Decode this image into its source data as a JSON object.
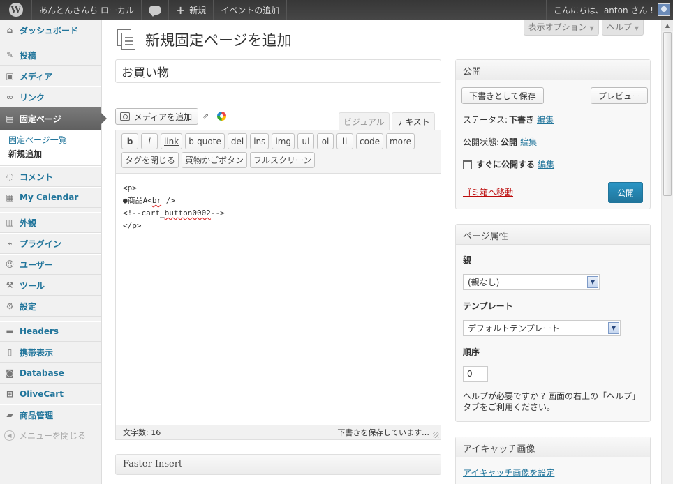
{
  "adminbar": {
    "site_name": "あんとんさんち ローカル",
    "new_label": "新規",
    "event_label": "イベントの追加",
    "greeting": "こんにちは、anton さん !"
  },
  "sidebar": {
    "items": [
      {
        "label": "ダッシュボード",
        "icon": "dashboard-icon"
      },
      {
        "label": "投稿",
        "icon": "pin-icon"
      },
      {
        "label": "メディア",
        "icon": "media-icon"
      },
      {
        "label": "リンク",
        "icon": "link-icon"
      },
      {
        "label": "固定ページ",
        "icon": "pages-icon"
      },
      {
        "label": "コメント",
        "icon": "comment-icon"
      },
      {
        "label": "My Calendar",
        "icon": "calendar-icon"
      },
      {
        "label": "外観",
        "icon": "appearance-icon"
      },
      {
        "label": "プラグイン",
        "icon": "plugin-icon"
      },
      {
        "label": "ユーザー",
        "icon": "users-icon"
      },
      {
        "label": "ツール",
        "icon": "tools-icon"
      },
      {
        "label": "設定",
        "icon": "settings-icon"
      },
      {
        "label": "Headers",
        "icon": "headers-icon"
      },
      {
        "label": "携帯表示",
        "icon": "mobile-icon"
      },
      {
        "label": "Database",
        "icon": "database-icon"
      },
      {
        "label": "OliveCart",
        "icon": "cart-icon"
      },
      {
        "label": "商品管理",
        "icon": "folder-icon"
      }
    ],
    "submenu": [
      "固定ページ一覧",
      "新規追加"
    ],
    "collapse_label": "メニューを閉じる"
  },
  "screen_meta": {
    "options": "表示オプション",
    "help": "ヘルプ"
  },
  "page": {
    "title": "新規固定ページを追加",
    "post_title": "お買い物"
  },
  "editor": {
    "media_button": "メディアを追加",
    "tab_visual": "ビジュアル",
    "tab_text": "テキスト",
    "quicktags_row1": [
      "b",
      "i",
      "link",
      "b-quote",
      "del",
      "ins",
      "img",
      "ul",
      "ol",
      "li",
      "code",
      "more"
    ],
    "quicktags_row2": [
      "タグを閉じる",
      "買物かごボタン",
      "フルスクリーン"
    ],
    "content": {
      "line1": "<p>",
      "line2_a": "●商品A<",
      "line2_b": "br",
      "line2_c": " />",
      "line3_a": "<!--cart_",
      "line3_b": "button0002",
      "line3_c": "-->",
      "line4": "</p>"
    },
    "word_count": "文字数: 16",
    "draft_status": "下書きを保存しています…"
  },
  "faster_insert": {
    "title": "Faster Insert"
  },
  "publish": {
    "title": "公開",
    "save_draft": "下書きとして保存",
    "preview": "プレビュー",
    "status_label": "ステータス:",
    "status_value": "下書き",
    "visibility_label": "公開状態:",
    "visibility_value": "公開",
    "schedule_value": "すぐに公開する",
    "edit": "編集",
    "trash": "ゴミ箱へ移動",
    "publish_button": "公開"
  },
  "page_attributes": {
    "title": "ページ属性",
    "parent_label": "親",
    "parent_value": "(親なし)",
    "template_label": "テンプレート",
    "template_value": "デフォルトテンプレート",
    "order_label": "順序",
    "order_value": "0",
    "help_text": "ヘルプが必要ですか ? 画面の右上の「ヘルプ」タブをご利用ください。"
  },
  "featured_image": {
    "title": "アイキャッチ画像",
    "link": "アイキャッチ画像を設定"
  },
  "colors": {
    "link": "#21759b",
    "trash": "#bc0b0b",
    "publish": "#21759b",
    "adminbar": "#464646"
  }
}
